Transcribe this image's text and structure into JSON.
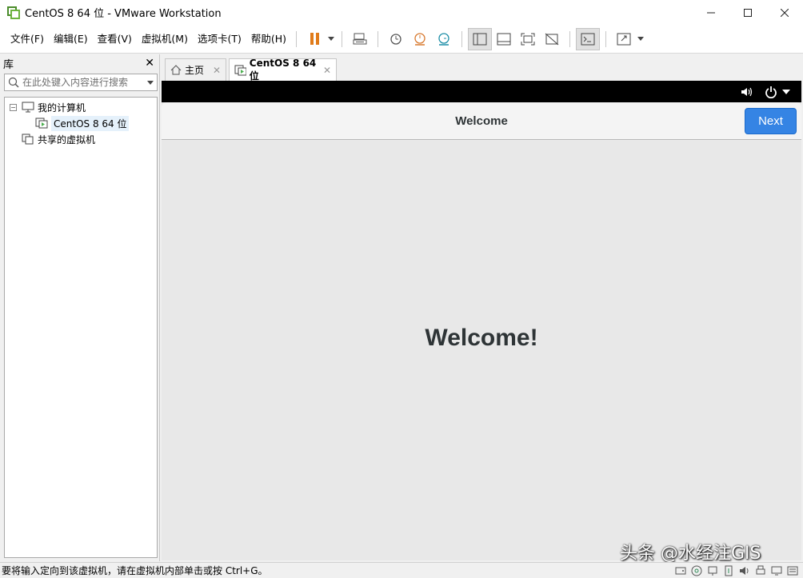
{
  "window": {
    "title": "CentOS 8 64 位 - VMware Workstation",
    "controls": [
      "minimize-icon",
      "maximize-icon",
      "close-icon"
    ]
  },
  "menu": {
    "items": [
      "文件(F)",
      "编辑(E)",
      "查看(V)",
      "虚拟机(M)",
      "选项卡(T)",
      "帮助(H)"
    ]
  },
  "library": {
    "title": "库",
    "search_placeholder": "在此处键入内容进行搜索",
    "tree": {
      "my_computer": "我的计算机",
      "vm_item": "CentOS 8 64 位",
      "shared_vms": "共享的虚拟机"
    }
  },
  "tabs": {
    "home": "主页",
    "vm": "CentOS 8 64 位"
  },
  "vm": {
    "header_title": "Welcome",
    "next_label": "Next",
    "heading": "Welcome!",
    "accent_color": "#3584e4"
  },
  "watermark": "头条 @水经注GIS",
  "statusbar": {
    "text": "要将输入定向到该虚拟机，请在虚拟机内部单击或按 Ctrl+G。"
  }
}
